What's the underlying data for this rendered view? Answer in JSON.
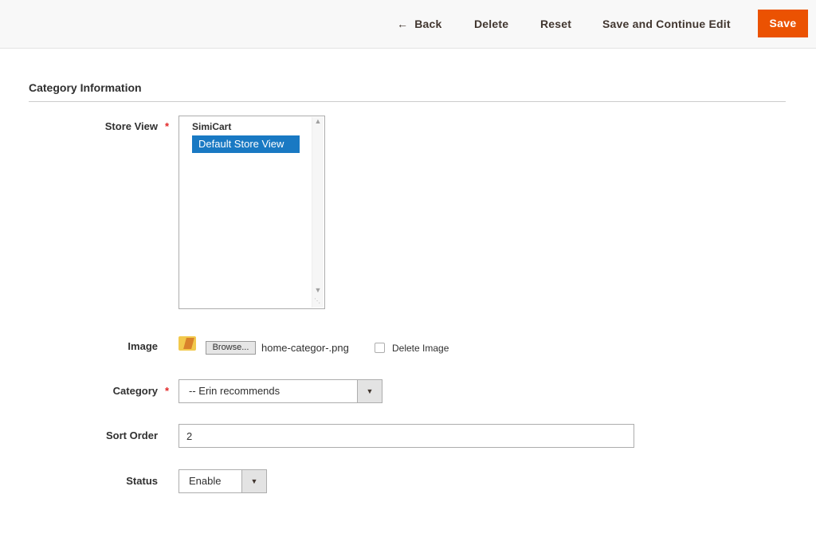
{
  "toolbar": {
    "back_label": "Back",
    "delete_label": "Delete",
    "reset_label": "Reset",
    "save_continue_label": "Save and Continue Edit",
    "save_label": "Save",
    "accent_color": "#eb5202"
  },
  "section": {
    "title": "Category Information"
  },
  "form": {
    "required_marker": "*",
    "store_view": {
      "label": "Store View",
      "group": "SimiCart",
      "options": [
        "Default Store View"
      ],
      "selected": "Default Store View",
      "selected_color": "#1979c3"
    },
    "image": {
      "label": "Image",
      "browse_label": "Browse...",
      "file_name": "home-categor-.png",
      "delete_label": "Delete Image",
      "delete_checked": false
    },
    "category": {
      "label": "Category",
      "value": "-- Erin recommends"
    },
    "sort_order": {
      "label": "Sort Order",
      "value": "2"
    },
    "status": {
      "label": "Status",
      "value": "Enable"
    }
  }
}
